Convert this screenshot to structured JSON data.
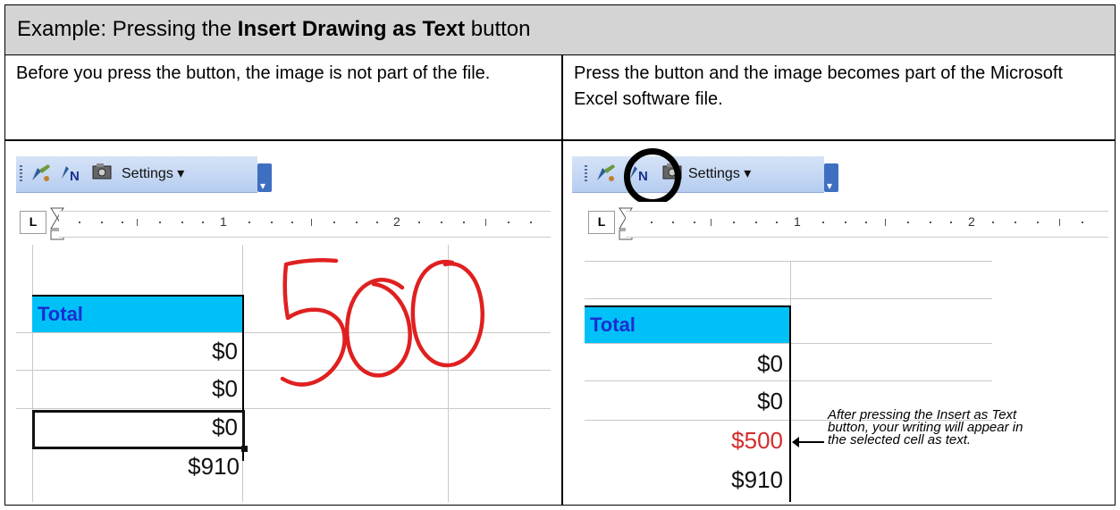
{
  "header": {
    "prefix": "Example: Pressing the ",
    "bold": "Insert Drawing as Text",
    "suffix": " button"
  },
  "before": {
    "description": "Before you press the button, the image is not part of the file.",
    "toolbar": {
      "settings_label": "Settings ▾"
    },
    "ruler": {
      "marks": [
        "1",
        "2"
      ],
      "tabstop": "L"
    },
    "sheet": {
      "header_label": "Total",
      "values": [
        "$0",
        "$0",
        "$0",
        "$910"
      ],
      "handwriting": "500",
      "handwriting_color": "#e02020"
    }
  },
  "after": {
    "description": "Press the button and the image becomes part of the Microsoft Excel software file.",
    "toolbar": {
      "settings_label": "Settings ▾"
    },
    "ruler": {
      "marks": [
        "1",
        "2"
      ],
      "tabstop": "L"
    },
    "sheet": {
      "header_label": "Total",
      "values": [
        "$0",
        "$0",
        "$500",
        "$910"
      ],
      "inserted_value_color": "#d42b2b"
    },
    "callout": {
      "lines": [
        "After pressing the Insert as Text",
        "button, your writing will appear in",
        "the selected cell as text."
      ]
    }
  },
  "icons": {
    "ink_pen": "pen-icon",
    "insert_text": "insert-drawing-as-text-icon",
    "camera": "camera-icon"
  }
}
